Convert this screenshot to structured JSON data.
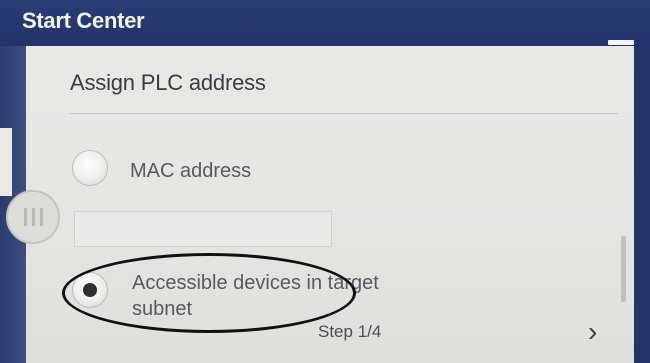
{
  "window": {
    "title": "Start Center"
  },
  "dialog": {
    "heading": "Assign PLC address",
    "options": [
      {
        "label": "MAC address",
        "selected": false
      },
      {
        "label": "Accessible devices in target subnet",
        "selected": true
      }
    ],
    "mac_field": {
      "value": "",
      "placeholder": ""
    },
    "step_label": "Step 1/4",
    "next_icon": "chevron-right-icon",
    "next_glyph": "›"
  },
  "colors": {
    "titlebar": "#22346a",
    "panel": "#e6e6e3",
    "annotation": "#111111"
  }
}
